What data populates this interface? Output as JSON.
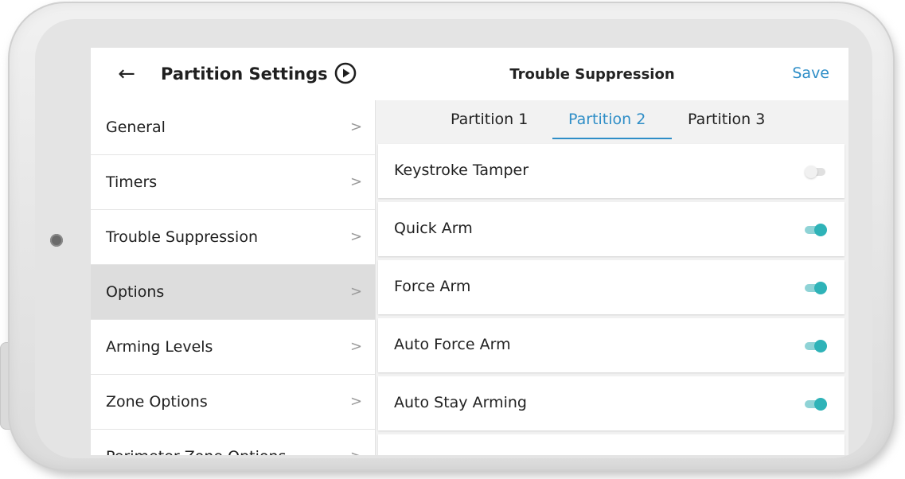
{
  "header": {
    "back_icon": "arrow-left-icon",
    "back_glyph": "←",
    "left_title": "Partition Settings",
    "play_icon": "play-circle-icon",
    "center_title": "Trouble Suppression",
    "save_label": "Save"
  },
  "sidebar": {
    "chevron": ">",
    "items": [
      {
        "label": "General"
      },
      {
        "label": "Timers"
      },
      {
        "label": "Trouble Suppression"
      },
      {
        "label": "Options"
      },
      {
        "label": "Arming Levels"
      },
      {
        "label": "Zone Options"
      },
      {
        "label": "Perimeter Zone Options"
      }
    ],
    "active_item": "Options"
  },
  "tabs": [
    {
      "label": "Partition 1"
    },
    {
      "label": "Partition 2"
    },
    {
      "label": "Partition 3"
    }
  ],
  "active_tab": "Partition 2",
  "settings": [
    {
      "label": "Keystroke Tamper",
      "enabled": false
    },
    {
      "label": "Quick Arm",
      "enabled": true
    },
    {
      "label": "Force Arm",
      "enabled": true
    },
    {
      "label": "Auto Force Arm",
      "enabled": true
    },
    {
      "label": "Auto Stay Arming",
      "enabled": true
    }
  ],
  "colors": {
    "accent": "#2f8ec7",
    "toggle_on": "#2fb3b8",
    "active_sidebar_bg": "#dddddd"
  }
}
